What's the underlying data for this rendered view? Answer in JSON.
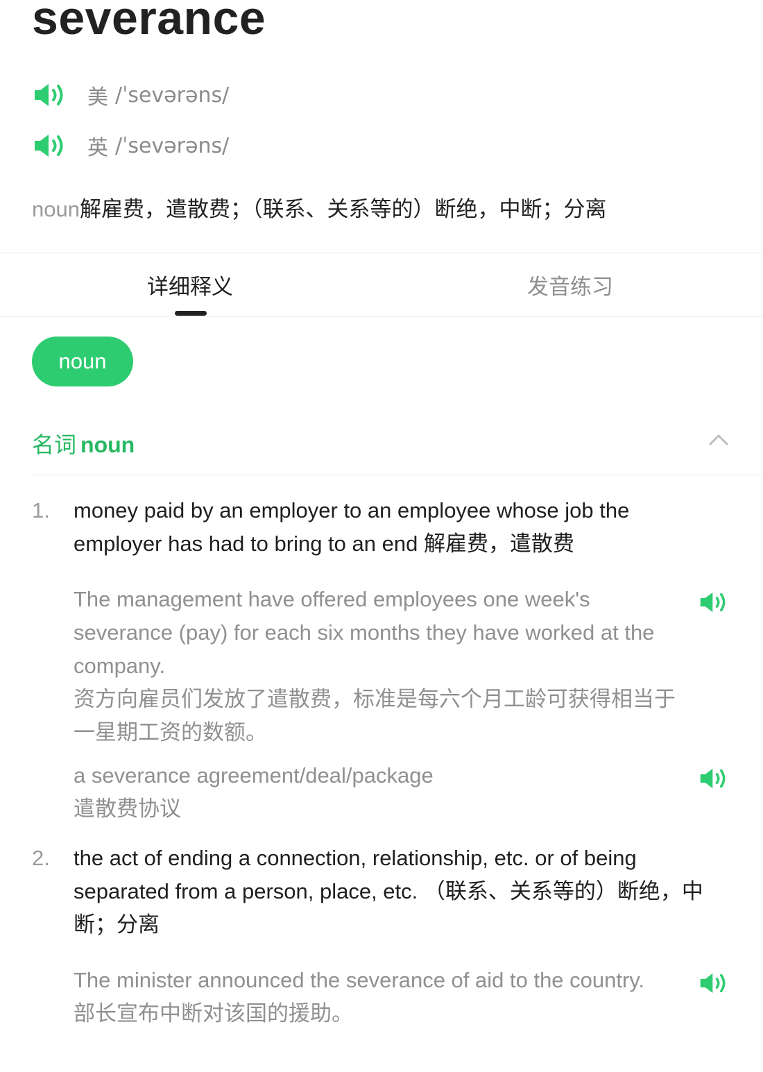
{
  "word": "severance",
  "pronunciations": [
    {
      "region": "美",
      "ipa": "/ˈsevərəns/"
    },
    {
      "region": "英",
      "ipa": "/ˈsevərəns/"
    }
  ],
  "summary": {
    "pos": "noun",
    "meaning": "解雇费，遣散费；（联系、关系等的）断绝，中断；分离"
  },
  "tabs": [
    {
      "label": "详细释义",
      "active": true
    },
    {
      "label": "发音练习",
      "active": false
    }
  ],
  "pos_filter": "noun",
  "section": {
    "zh": "名词",
    "en": "noun"
  },
  "senses": [
    {
      "num": "1.",
      "en": "money paid by an employer to an employee whose job the employer has had to bring to an end",
      "zh": "解雇费，遣散费",
      "examples": [
        {
          "en": "The management have offered employees one week's severance (pay) for each six months they have worked at the company.",
          "zh": "资方向雇员们发放了遣散费，标准是每六个月工龄可获得相当于一星期工资的数额。"
        },
        {
          "en": "a severance agreement/deal/package",
          "zh": "遣散费协议"
        }
      ]
    },
    {
      "num": "2.",
      "en": "the act of ending a connection, relationship, etc. or of being separated from a person, place, etc.",
      "zh": "（联系、关系等的）断绝，中断；分离",
      "examples": [
        {
          "en": "The minister announced the severance of aid to the country.",
          "zh": "部长宣布中断对该国的援助。"
        }
      ]
    }
  ],
  "icons": {
    "speaker": "speaker-icon",
    "collapse": "chevron-up-icon"
  },
  "colors": {
    "accent": "#2ecc71",
    "accent_text": "#27b862",
    "muted": "#909090"
  }
}
